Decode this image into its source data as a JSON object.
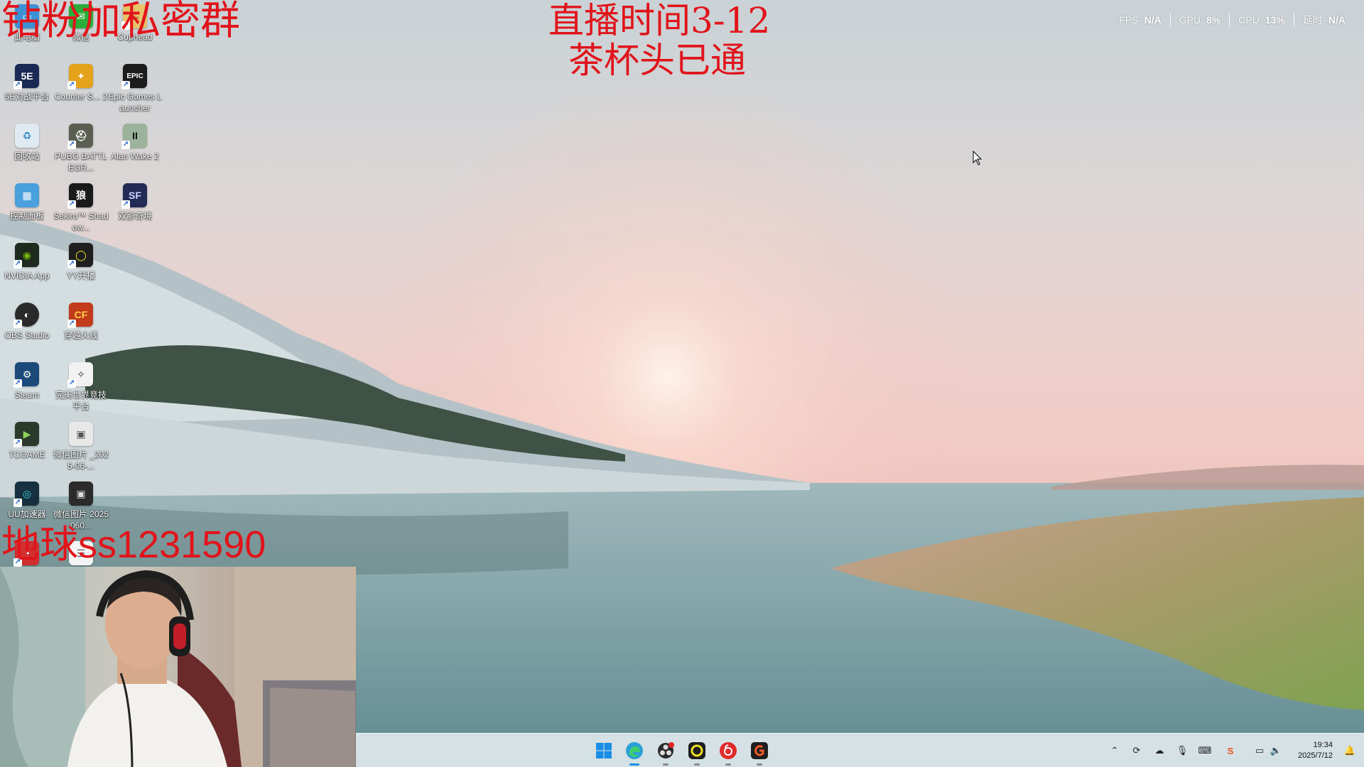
{
  "overlay": {
    "top_left": "钻粉加私密群",
    "center_line1": "直播时间3-12",
    "center_line2": "茶杯头已通",
    "bottom_left": "地球ss1231590"
  },
  "perf": {
    "fps_label": "FPS",
    "fps_value": "N/A",
    "gpu_label": "GPU",
    "gpu_value": "8%",
    "cpu_label": "CPU",
    "cpu_value": "13%",
    "latency_label": "延时",
    "latency_value": "N/A"
  },
  "desktop_icons": {
    "computer": "此电脑",
    "wechat": "微信",
    "cuphead": "Cuphead",
    "5e": "5E对战平台",
    "cs2": "Counter S... 2",
    "epic": "Epic Games Launcher",
    "recycle": "回收站",
    "pubg": "PUBG BATTLEGR...",
    "alanwake": "Alan Wake 2",
    "control": "控制面板",
    "sekiro": "Sekiro™ Shadow...",
    "splitfiction": "双影奇境",
    "nvidia": "NVIDIA App",
    "yy": "YY开播",
    "obs": "OBS Studio",
    "cf": "穿越火线",
    "steam": "Steam",
    "perfectworld": "完美世界竞技平台",
    "tcgame": "TCGAME",
    "wximg1": "微信图片 _2025-06-...",
    "uu": "UU加速器",
    "wximg2": "微信图片 2025060..."
  },
  "icon_glyphs": {
    "5e": "5E",
    "epic": "EPIC",
    "alanwake": "II",
    "sekiro": "狼",
    "splitfiction": "SF"
  },
  "taskbar": {
    "time": "19:34",
    "date": "2025/7/12"
  },
  "colors": {
    "overlay_red": "#e0141a",
    "taskbar_bg": "#dee8ec"
  }
}
